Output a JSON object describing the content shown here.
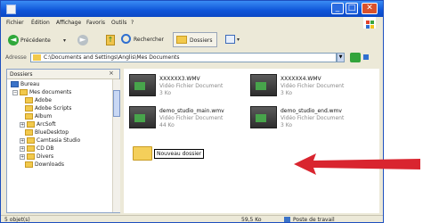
{
  "window": {
    "title": "",
    "controls": {
      "minimize": "_",
      "maximize": "□",
      "close": "✕"
    }
  },
  "menu": [
    "Fichier",
    "Édition",
    "Affichage",
    "Favoris",
    "Outils",
    "?"
  ],
  "toolbar": {
    "back_label": "Précédente",
    "search_label": "Rechercher",
    "folders_label": "Dossiers"
  },
  "address": {
    "label": "Adresse",
    "value": "C:\\Documents and Settings\\Anglis\\Mes Documents",
    "go_label": "OK"
  },
  "folders_pane": {
    "title": "Dossiers",
    "close": "×",
    "items": [
      {
        "label": "Bureau",
        "expander": ""
      },
      {
        "label": "Mes documents",
        "expander": "−"
      },
      {
        "label": "Adobe",
        "expander": ""
      },
      {
        "label": "Adobe Scripts",
        "expander": ""
      },
      {
        "label": "Album",
        "expander": ""
      },
      {
        "label": "ArcSoft",
        "expander": "+"
      },
      {
        "label": "BlueDesktop",
        "expander": ""
      },
      {
        "label": "Camtasia Studio",
        "expander": "+"
      },
      {
        "label": "CD DB",
        "expander": "+"
      },
      {
        "label": "Divers",
        "expander": "+"
      },
      {
        "label": "Downloads",
        "expander": ""
      }
    ]
  },
  "files": [
    {
      "name": "XXXXXX3.WMV",
      "type": "Vidéo Fichier Document",
      "size": "3 Ko"
    },
    {
      "name": "XXXXXX4.WMV",
      "type": "Vidéo Fichier Document",
      "size": "3 Ko"
    },
    {
      "name": "demo_studio_main.wmv",
      "type": "Vidéo Fichier Document",
      "size": "44 Ko"
    },
    {
      "name": "demo_studio_end.wmv",
      "type": "Vidéo Fichier Document",
      "size": "3 Ko"
    }
  ],
  "new_folder": {
    "label": "Nouveau dossier"
  },
  "status": {
    "left": "5 objet(s)",
    "size": "59,5 Ko",
    "zone": "Poste de travail"
  },
  "colors": {
    "titlebar": "#0f55d8",
    "window_bg": "#ece9d8",
    "callout_arrow": "#d9252f"
  }
}
